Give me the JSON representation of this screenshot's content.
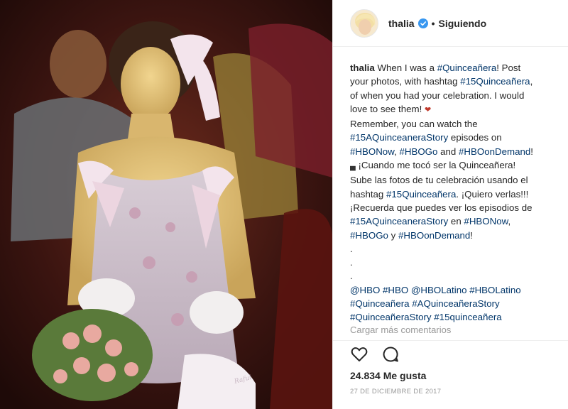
{
  "post": {
    "username": "thalia",
    "follow_status": "Siguiendo",
    "separator": "•",
    "caption_user": "thalia",
    "caption_lines": [
      [
        {
          "t": "When I was a "
        },
        {
          "t": "#Quinceañera",
          "tag": true
        },
        {
          "t": "! Post"
        }
      ],
      [
        {
          "t": "your photos, with hashtag "
        },
        {
          "t": "#15Quinceañera",
          "tag": true
        },
        {
          "t": ","
        }
      ],
      [
        {
          "t": "of when you had your celebration. I would"
        }
      ],
      [
        {
          "t": "love to see them! "
        },
        {
          "t": "❤",
          "emoji": true
        }
      ],
      [
        {
          "t": "Remember, you can watch the"
        }
      ],
      [
        {
          "t": "#15AQuinceaneraStory",
          "tag": true
        },
        {
          "t": " episodes on"
        }
      ],
      [
        {
          "t": "#HBONow",
          "tag": true
        },
        {
          "t": ", "
        },
        {
          "t": "#HBOGo",
          "tag": true
        },
        {
          "t": " and "
        },
        {
          "t": "#HBOonDemand",
          "tag": true
        },
        {
          "t": "!"
        }
      ],
      [
        {
          "t": "▄",
          "emoji": true
        },
        {
          "t": " ¡Cuando me tocó ser la Quinceañera!"
        }
      ],
      [
        {
          "t": "Sube las fotos de tu celebración usando el"
        }
      ],
      [
        {
          "t": "hashtag "
        },
        {
          "t": "#15Quinceañera",
          "tag": true
        },
        {
          "t": ". ¡Quiero verlas!!!"
        }
      ],
      [
        {
          "t": "¡Recuerda que puedes ver los episodios de"
        }
      ],
      [
        {
          "t": "#15AQuinceaneraStory",
          "tag": true
        },
        {
          "t": " en "
        },
        {
          "t": "#HBONow",
          "tag": true
        },
        {
          "t": ","
        }
      ],
      [
        {
          "t": "#HBOGo",
          "tag": true
        },
        {
          "t": " y "
        },
        {
          "t": "#HBOonDemand",
          "tag": true
        },
        {
          "t": "!"
        }
      ],
      [
        {
          "t": "."
        }
      ],
      [
        {
          "t": "."
        }
      ],
      [
        {
          "t": "."
        }
      ],
      [
        {
          "t": "@HBO",
          "tag": true
        },
        {
          "t": " "
        },
        {
          "t": "#HBO",
          "tag": true
        },
        {
          "t": " "
        },
        {
          "t": "@HBOLatino",
          "tag": true
        },
        {
          "t": " "
        },
        {
          "t": "#HBOLatino",
          "tag": true
        }
      ],
      [
        {
          "t": "#Quinceañera",
          "tag": true
        },
        {
          "t": " "
        },
        {
          "t": "#AQuinceañeraStory",
          "tag": true
        }
      ],
      [
        {
          "t": "#QuinceañeraStory",
          "tag": true
        },
        {
          "t": " "
        },
        {
          "t": "#15quinceañera",
          "tag": true
        }
      ]
    ],
    "load_more": "Cargar más comentarios",
    "likes": "24.834 Me gusta",
    "date": "27 DE DICIEMBRE DE 2017",
    "photo_signature": "Raful"
  },
  "icons": {
    "verified": "verified-badge-icon",
    "like": "heart-icon",
    "comment": "comment-icon"
  },
  "colors": {
    "hashtag": "#003569",
    "verified": "#3897f0",
    "muted": "#999999"
  }
}
